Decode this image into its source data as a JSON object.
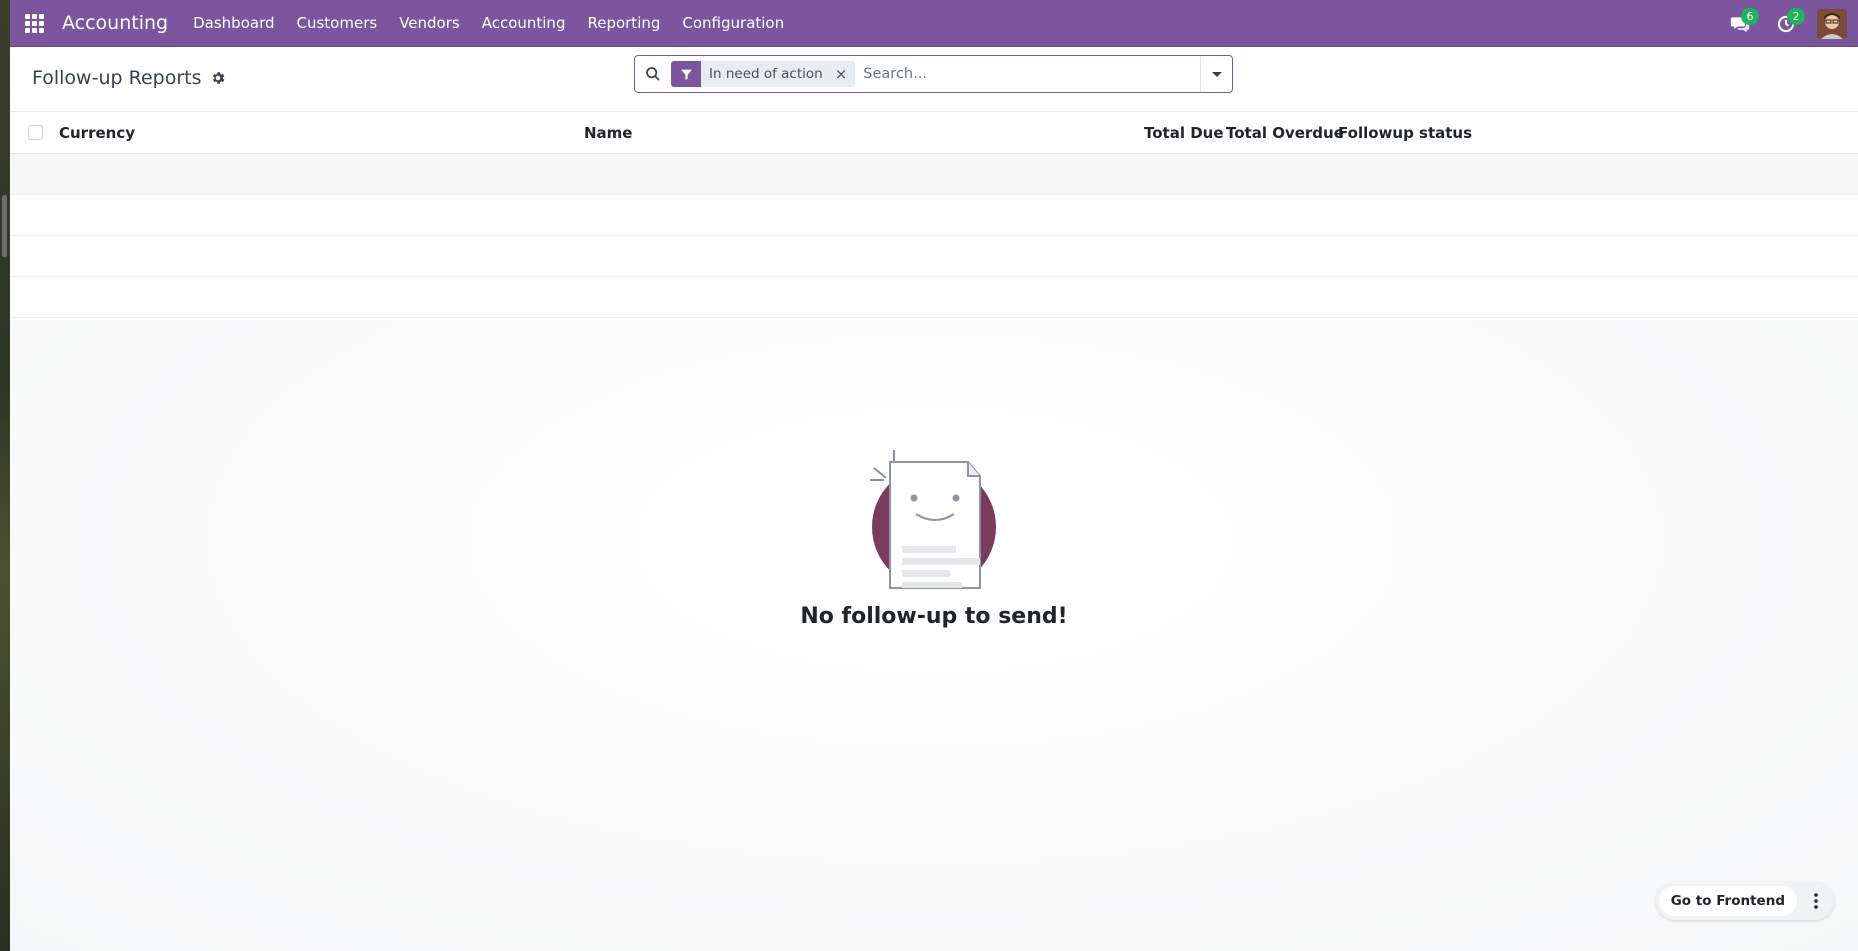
{
  "app": {
    "brand": "Accounting"
  },
  "navbar": {
    "menu": [
      "Dashboard",
      "Customers",
      "Vendors",
      "Accounting",
      "Reporting",
      "Configuration"
    ],
    "messages_count": "6",
    "activities_count": "2"
  },
  "control_panel": {
    "title": "Follow-up Reports",
    "search": {
      "facet_label": "In need of action",
      "facet_remove": "×",
      "placeholder": "Search..."
    }
  },
  "list": {
    "columns": [
      "Currency",
      "Name",
      "Total Due",
      "Total Overdue",
      "Followup status"
    ]
  },
  "empty_state": {
    "title": "No follow-up to send!"
  },
  "footer": {
    "go_frontend": "Go to Frontend"
  },
  "colors": {
    "brand": "#7c559f",
    "badge": "#21b25a",
    "illustration_circle": "#7a3b5e"
  },
  "icons": [
    "apps-grid-icon",
    "chat-icon",
    "clock-icon",
    "gear-icon",
    "search-icon",
    "filter-icon",
    "caret-down-icon",
    "kebab-icon"
  ]
}
